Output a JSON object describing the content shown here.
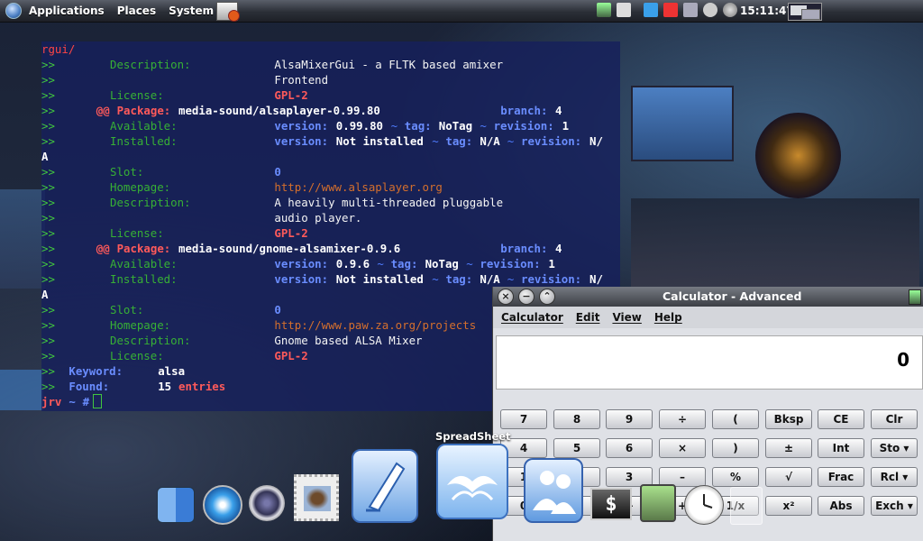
{
  "panel": {
    "menus": [
      "Applications",
      "Places",
      "System"
    ],
    "clock": "15:11:47"
  },
  "terminal": {
    "path": "rgui/",
    "lines": [
      {
        "type": "field",
        "label": "Description:",
        "value": "AlsaMixerGui - a FLTK based amixer"
      },
      {
        "type": "cont",
        "value": "Frontend"
      },
      {
        "type": "license",
        "label": "License:",
        "value": "GPL-2"
      },
      {
        "type": "package",
        "marker": "@@",
        "label": "Package:",
        "name": "media-sound/alsaplayer-0.99.80",
        "branch_label": "branch:",
        "branch": "4"
      },
      {
        "type": "avail",
        "label": "Available:",
        "version": "0.99.80",
        "tag": "NoTag",
        "revision": "1"
      },
      {
        "type": "installed",
        "label": "Installed:",
        "version": "Not installed",
        "tag": "N/A",
        "revision": "N/",
        "wrap": "A"
      },
      {
        "type": "slot",
        "label": "Slot:",
        "value": "0"
      },
      {
        "type": "home",
        "label": "Homepage:",
        "value": "http://www.alsaplayer.org"
      },
      {
        "type": "field",
        "label": "Description:",
        "value": "A heavily multi-threaded pluggable"
      },
      {
        "type": "cont",
        "value": "audio player."
      },
      {
        "type": "license",
        "label": "License:",
        "value": "GPL-2"
      },
      {
        "type": "package",
        "marker": "@@",
        "label": "Package:",
        "name": "media-sound/gnome-alsamixer-0.9.6",
        "branch_label": "branch:",
        "branch": "4"
      },
      {
        "type": "avail",
        "label": "Available:",
        "version": "0.9.6",
        "tag": "NoTag",
        "revision": "1"
      },
      {
        "type": "installed",
        "label": "Installed:",
        "version": "Not installed",
        "tag": "N/A",
        "revision": "N/",
        "wrap": "A"
      },
      {
        "type": "slot",
        "label": "Slot:",
        "value": "0"
      },
      {
        "type": "home",
        "label": "Homepage:",
        "value": "http://www.paw.za.org/projects"
      },
      {
        "type": "field",
        "label": "Description:",
        "value": "Gnome based ALSA Mixer"
      },
      {
        "type": "license",
        "label": "License:",
        "value": "GPL-2"
      },
      {
        "type": "keyword",
        "label": "Keyword:",
        "value": "alsa"
      },
      {
        "type": "found",
        "label": "Found:",
        "count": "15",
        "word": "entries"
      }
    ],
    "prompt_user": "jrv",
    "prompt_sym": "#",
    "words": {
      "version": "version:",
      "tag": "tag:",
      "revision": "revision:",
      "tilde": "~"
    }
  },
  "calculator": {
    "title": "Calculator - Advanced",
    "menu": [
      "Calculator",
      "Edit",
      "View",
      "Help"
    ],
    "display": "0",
    "keys": [
      [
        "7",
        "8",
        "9",
        "÷",
        "(",
        "Bksp",
        "CE",
        "Clr"
      ],
      [
        "4",
        "5",
        "6",
        "×",
        ")",
        "±",
        "Int",
        "Sto ▾"
      ],
      [
        "1",
        "2",
        "3",
        "–",
        "%",
        "√",
        "Frac",
        "Rcl ▾"
      ],
      [
        "0",
        ".",
        "+",
        "+",
        "1/x",
        "x²",
        "Abs",
        "Exch ▾"
      ]
    ]
  },
  "dock": {
    "hover_label": "SpreadSheet"
  },
  "colors": {
    "terminal_bg": "#16205c",
    "green": "#41c63f",
    "blue": "#4f7cff",
    "red": "#ff4545"
  }
}
